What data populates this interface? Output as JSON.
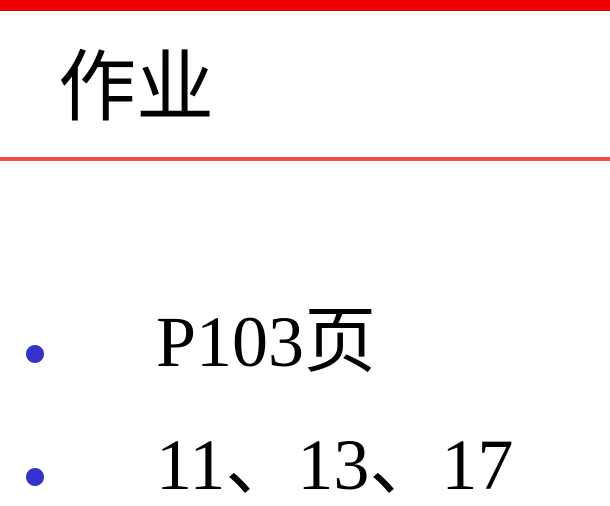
{
  "slide": {
    "title": "作业",
    "bullets": [
      {
        "text": "P103页"
      },
      {
        "text": "11、13、17"
      }
    ]
  },
  "colors": {
    "top_bar": "#ee0000",
    "title_rule": "#f04a4a",
    "bullet": "#3333cc",
    "text": "#000000",
    "background": "#ffffff"
  }
}
